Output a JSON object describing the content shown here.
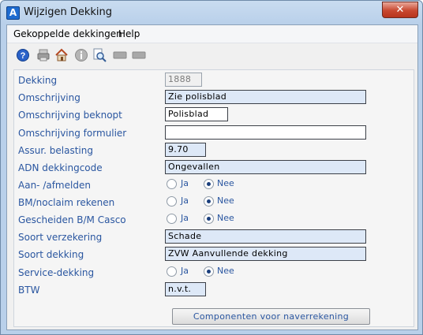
{
  "window": {
    "title": "Wijzigen Dekking",
    "close_label": "✕"
  },
  "menu": {
    "items": [
      "Gekoppelde dekkingen",
      "Help"
    ]
  },
  "toolbar": {
    "icons": [
      "help-icon",
      "print-icon",
      "home-icon",
      "info-icon",
      "search-icon",
      "disabled-icon-1",
      "disabled-icon-2"
    ]
  },
  "form": {
    "dekking": {
      "label": "Dekking",
      "value": "1888"
    },
    "omschrijving": {
      "label": "Omschrijving",
      "value": "Zie polisblad"
    },
    "omschrijving_beknopt": {
      "label": "Omschrijving beknopt",
      "value": "Polisblad"
    },
    "omschrijving_formulier": {
      "label": "Omschrijving formulier",
      "value": ""
    },
    "assur_belasting": {
      "label": "Assur. belasting",
      "value": "9.70"
    },
    "adn_dekkingcode": {
      "label": "ADN dekkingcode",
      "value": "Ongevallen"
    },
    "aan_afmelden": {
      "label": "Aan- /afmelden",
      "ja": "Ja",
      "nee": "Nee",
      "selected": "Nee"
    },
    "bm_noclaim": {
      "label": "BM/noclaim rekenen",
      "ja": "Ja",
      "nee": "Nee",
      "selected": "Nee"
    },
    "gescheiden_bm": {
      "label": "Gescheiden B/M Casco",
      "ja": "Ja",
      "nee": "Nee",
      "selected": "Nee"
    },
    "soort_verzekering": {
      "label": "Soort verzekering",
      "value": "Schade"
    },
    "soort_dekking": {
      "label": "Soort dekking",
      "value": "ZVW Aanvullende dekking"
    },
    "service_dekking": {
      "label": "Service-dekking",
      "ja": "Ja",
      "nee": "Nee",
      "selected": "Nee"
    },
    "btw": {
      "label": "BTW",
      "value": "n.v.t."
    },
    "componenten_button": "Componenten voor naverrekening"
  }
}
